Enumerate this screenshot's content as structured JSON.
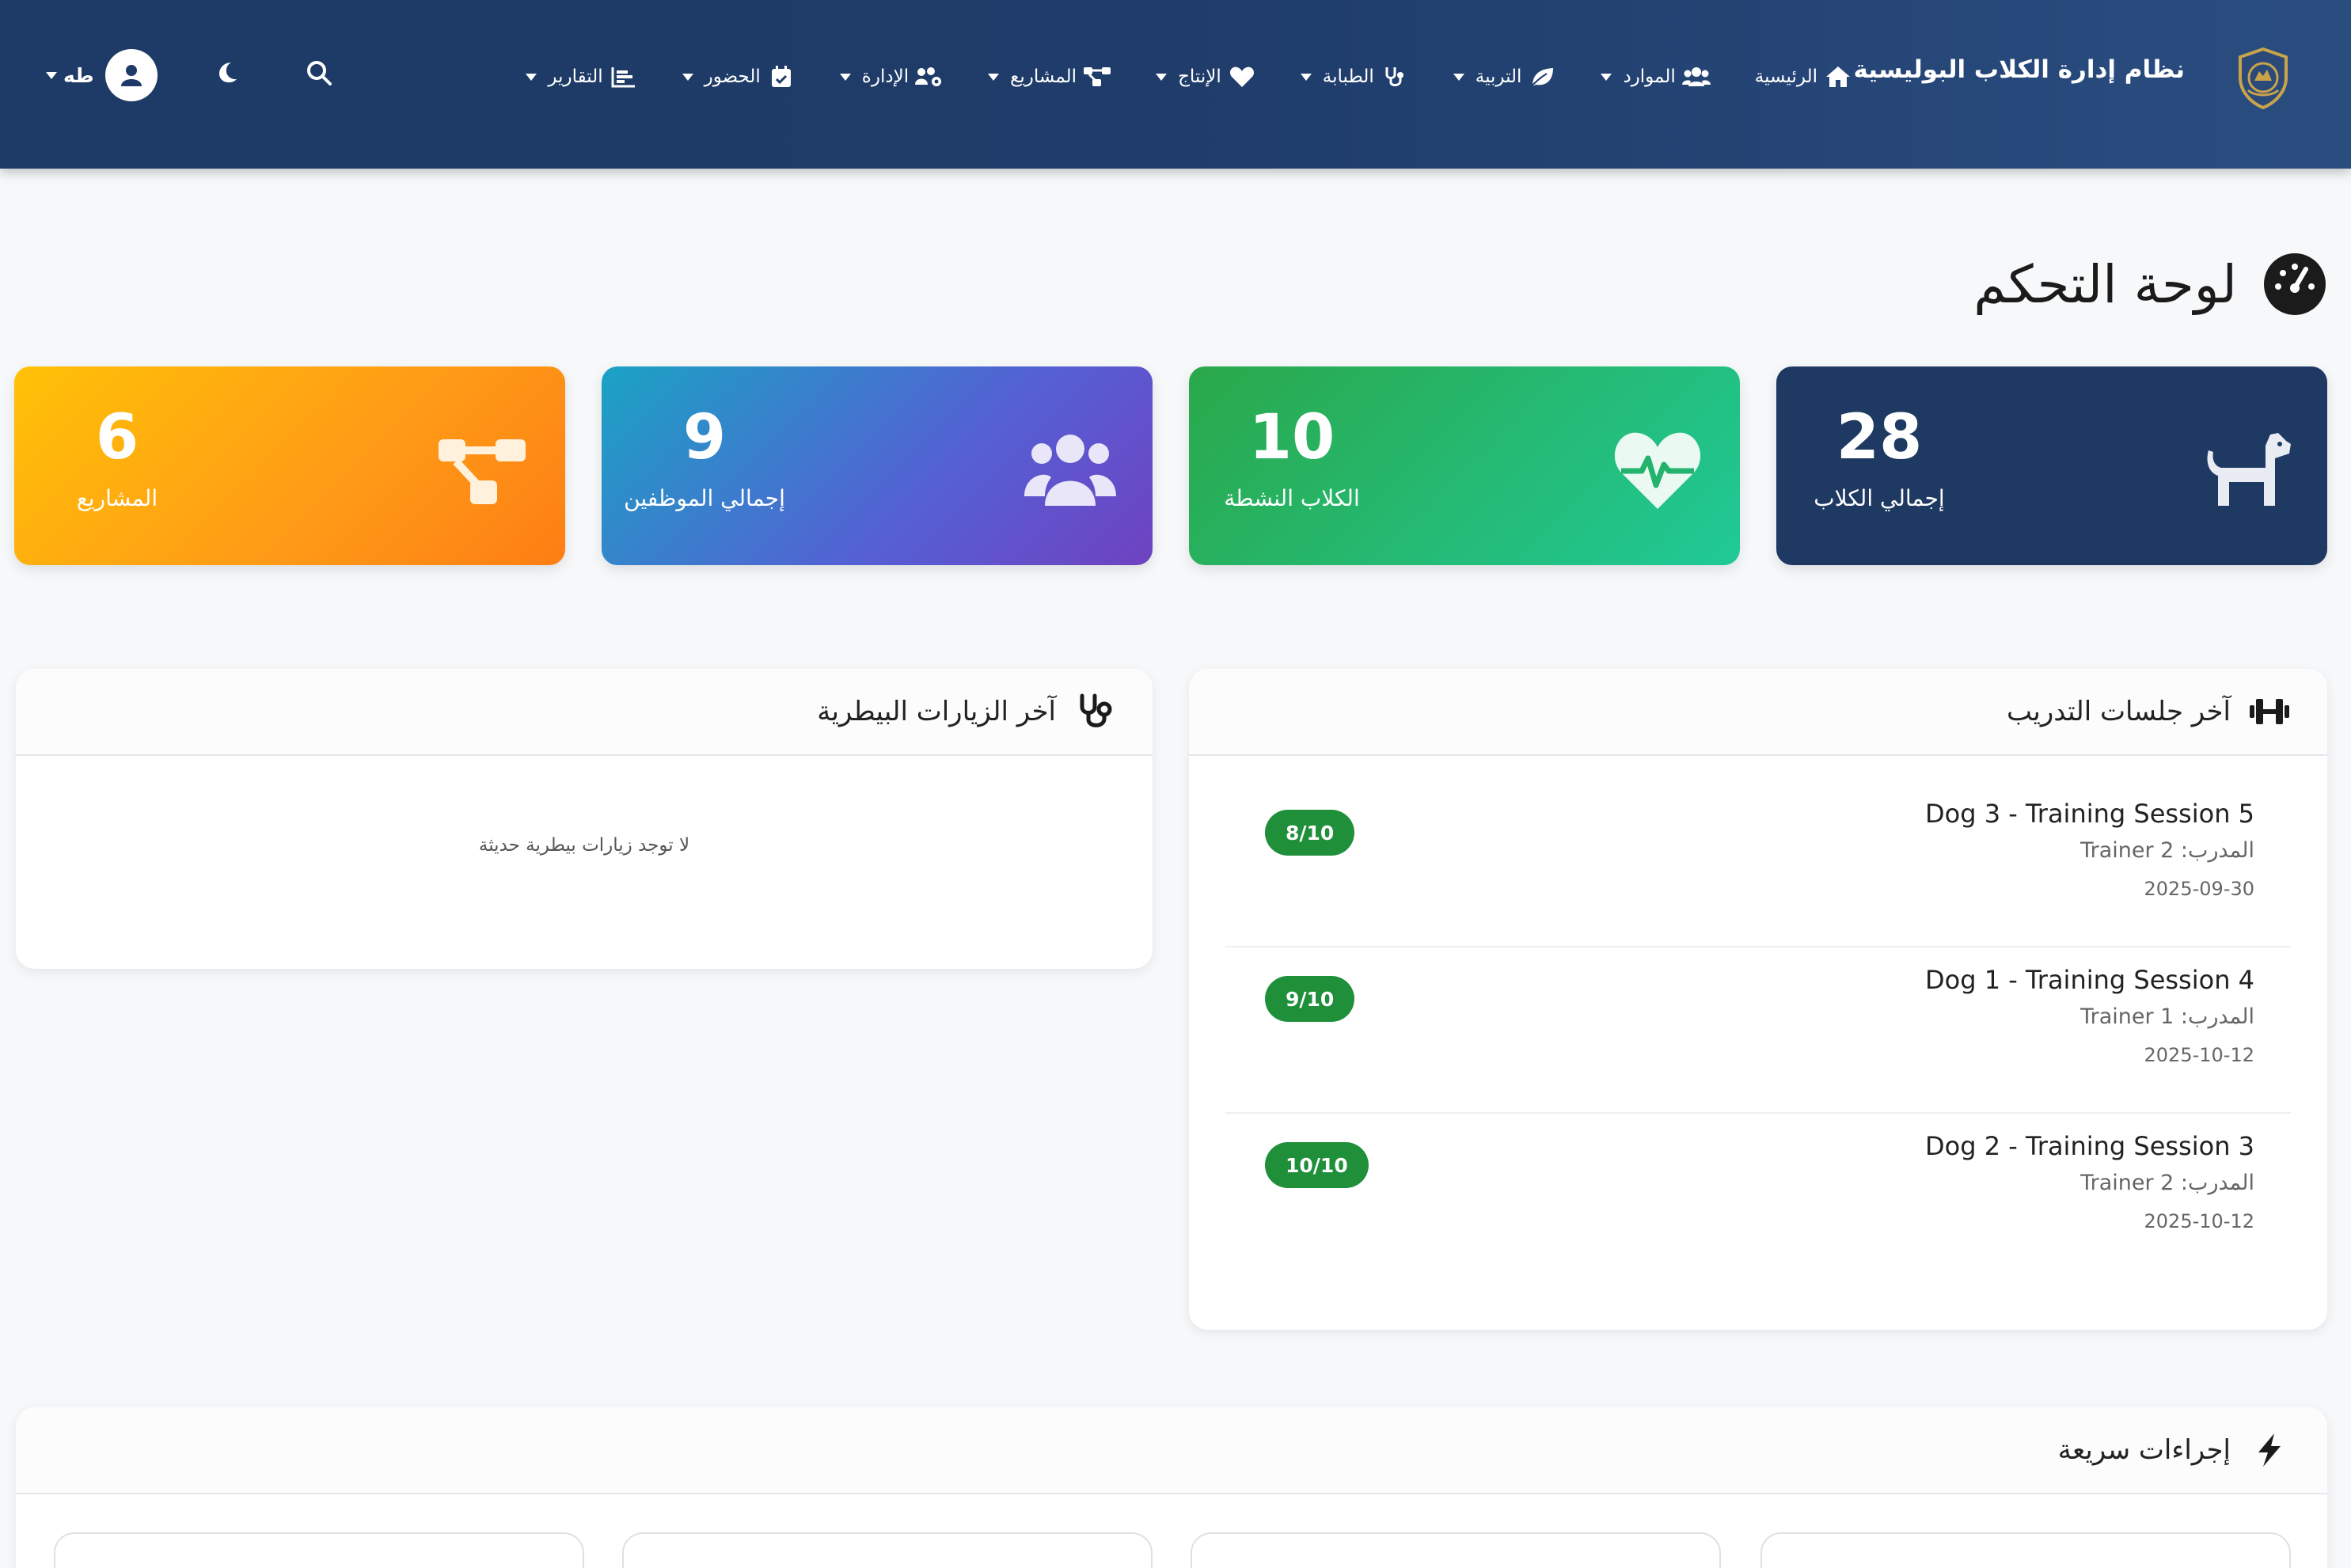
{
  "app": {
    "brand_name": "نظام إدارة الكلاب البوليسية"
  },
  "nav": {
    "items": [
      {
        "label": "الرئيسية",
        "icon": "home-icon"
      },
      {
        "label": "الموارد",
        "icon": "users-icon"
      },
      {
        "label": "التربية",
        "icon": "leaf-icon"
      },
      {
        "label": "الطبابة",
        "icon": "stethoscope-icon"
      },
      {
        "label": "الإنتاج",
        "icon": "heart-icon"
      },
      {
        "label": "المشاريع",
        "icon": "project-diagram-icon"
      },
      {
        "label": "الإدارة",
        "icon": "users-cog-icon"
      },
      {
        "label": "الحضور",
        "icon": "calendar-check-icon"
      },
      {
        "label": "التقارير",
        "icon": "chart-bar-icon"
      }
    ],
    "user_name": "طه"
  },
  "page": {
    "title": "لوحة التحكم"
  },
  "stats": {
    "total_dogs": {
      "value": "28",
      "label": "إجمالي الكلاب",
      "icon": "dog-icon",
      "color": "#1f3a62"
    },
    "active_dogs": {
      "value": "10",
      "label": "الكلاب النشطة",
      "icon": "heartbeat-icon",
      "color": "#20c997"
    },
    "total_staff": {
      "value": "9",
      "label": "إجمالي الموظفين",
      "icon": "users-icon",
      "color": "#6f42c1"
    },
    "projects": {
      "value": "6",
      "label": "المشاريع",
      "icon": "project-diagram-icon",
      "color": "#fd7e14"
    }
  },
  "training": {
    "title": "آخر جلسات التدريب",
    "sessions": [
      {
        "title": "Dog 3 - Training Session 5",
        "trainer": "المدرب: Trainer 2",
        "date": "2025-09-30",
        "score": "8/10"
      },
      {
        "title": "Dog 1 - Training Session 4",
        "trainer": "المدرب: Trainer 1",
        "date": "2025-10-12",
        "score": "9/10"
      },
      {
        "title": "Dog 2 - Training Session 3",
        "trainer": "المدرب: Trainer 2",
        "date": "2025-10-12",
        "score": "10/10"
      }
    ]
  },
  "vet": {
    "title": "آخر الزيارات البيطرية",
    "empty_text": "لا توجد زيارات بيطرية حديثة"
  },
  "quick_actions": {
    "title": "إجراءات سريعة"
  },
  "colors": {
    "navbar": "#1e3a66",
    "badge": "#1f8f3a"
  }
}
